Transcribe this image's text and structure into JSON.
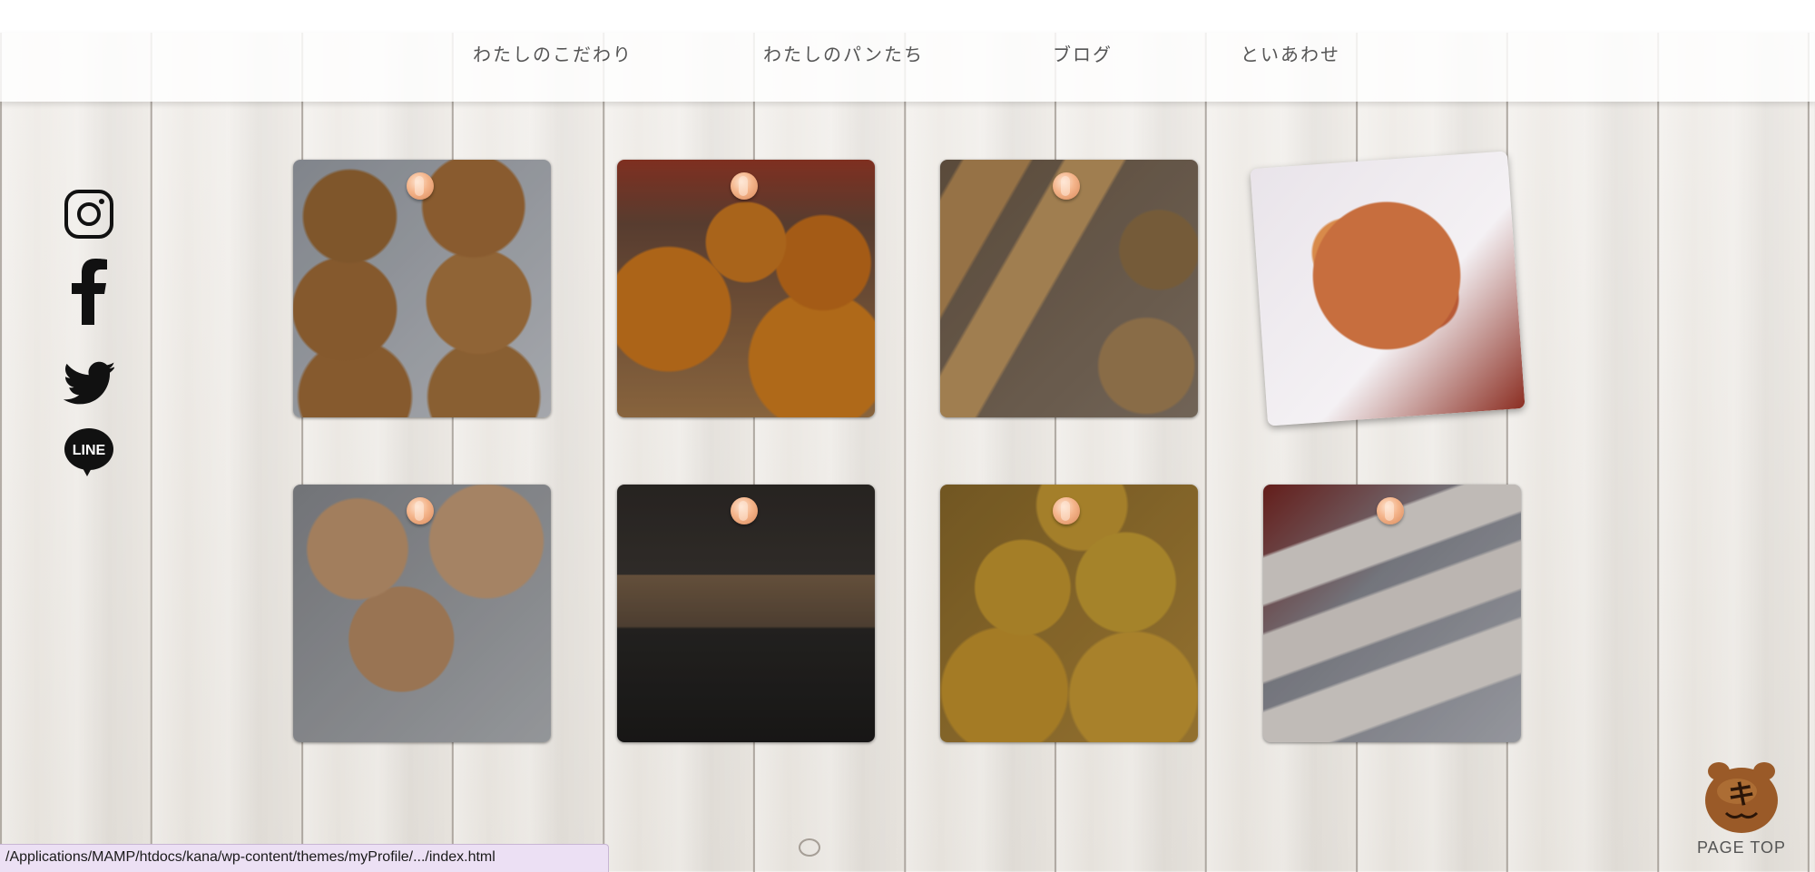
{
  "nav": {
    "items": [
      {
        "label": "わたしのこだわり"
      },
      {
        "label": "わたしのパンたち"
      },
      {
        "label": "ブログ"
      },
      {
        "label": "といあわせ"
      }
    ]
  },
  "social": {
    "items": [
      {
        "icon": "instagram-icon"
      },
      {
        "icon": "facebook-icon"
      },
      {
        "icon": "twitter-icon"
      },
      {
        "icon": "line-icon",
        "label": "LINE"
      }
    ]
  },
  "gallery": {
    "items": [
      {
        "subject": "cat-face-buns"
      },
      {
        "subject": "cross-cut-round-breads"
      },
      {
        "subject": "baguettes"
      },
      {
        "subject": "bacon-pizza-bread"
      },
      {
        "subject": "glazed-donut-sandwiches"
      },
      {
        "subject": "oven-baking-trays"
      },
      {
        "subject": "jack-o-lantern-melon-buns"
      },
      {
        "subject": "strawberry-cream-eclairs"
      }
    ]
  },
  "page_top": {
    "label": "PAGE TOP",
    "mascot_text": "キ"
  },
  "status_bar": {
    "url": "/Applications/MAMP/htdocs/kana/wp-content/themes/myProfile/.../index.html"
  },
  "colors": {
    "header_bg": "#ffffff",
    "nav_text": "#555555",
    "pin": "#f4b48a",
    "status_bg": "#ece0f4"
  }
}
